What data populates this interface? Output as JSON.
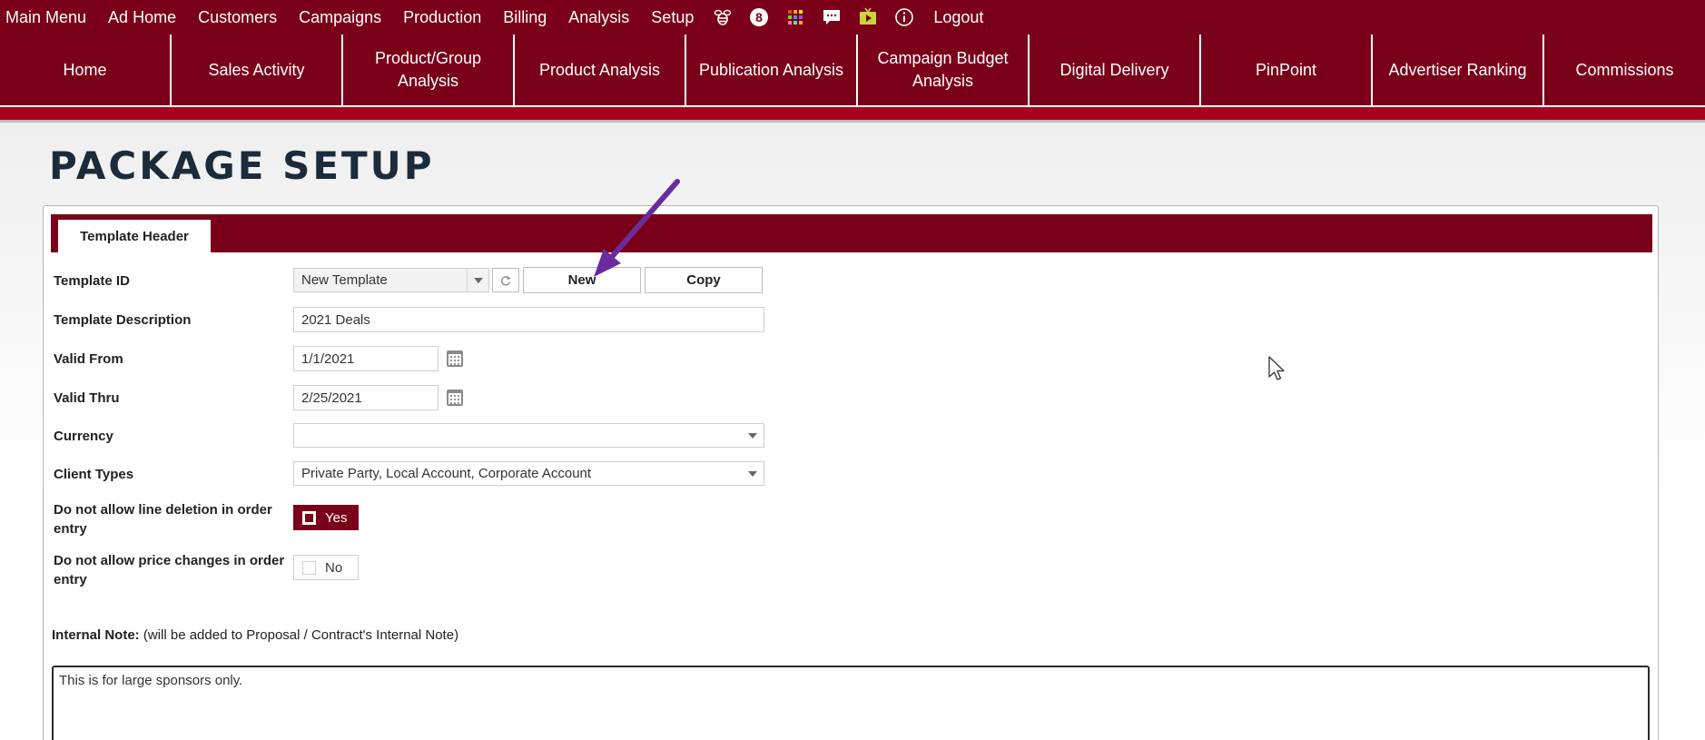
{
  "top_menu": {
    "items": [
      "Main Menu",
      "Ad Home",
      "Customers",
      "Campaigns",
      "Production",
      "Billing",
      "Analysis",
      "Setup"
    ],
    "notification_count": "8",
    "logout_label": "Logout",
    "icons": [
      "bee-icon",
      "notification-badge-icon",
      "apps-grid-icon",
      "chat-icon",
      "tv-play-icon",
      "info-icon"
    ]
  },
  "sub_nav": {
    "tabs": [
      "Home",
      "Sales Activity",
      "Product/Group Analysis",
      "Product Analysis",
      "Publication Analysis",
      "Campaign Budget Analysis",
      "Digital Delivery",
      "PinPoint",
      "Advertiser Ranking",
      "Commissions"
    ]
  },
  "page": {
    "title": "PACKAGE SETUP",
    "tab_label": "Template Header"
  },
  "form": {
    "template_id": {
      "label": "Template ID",
      "value": "New Template"
    },
    "new_button": "New",
    "copy_button": "Copy",
    "template_description": {
      "label": "Template Description",
      "value": "2021 Deals"
    },
    "valid_from": {
      "label": "Valid From",
      "value": "1/1/2021"
    },
    "valid_thru": {
      "label": "Valid Thru",
      "value": "2/25/2021"
    },
    "currency": {
      "label": "Currency",
      "value": ""
    },
    "client_types": {
      "label": "Client Types",
      "value": "Private Party, Local Account, Corporate Account"
    },
    "no_line_deletion": {
      "label": "Do not allow line deletion in order entry",
      "value": "Yes",
      "checked": true
    },
    "no_price_changes": {
      "label": "Do not allow price changes in order entry",
      "value": "No",
      "checked": false
    }
  },
  "internal_note": {
    "label": "Internal Note:",
    "hint": "(will be added to Proposal / Contract's Internal Note)",
    "value": "This is for large sponsors only."
  },
  "colors": {
    "brand": "#7a0019",
    "stripe": "#a8001c",
    "annotation_arrow": "#6a2c9c"
  }
}
